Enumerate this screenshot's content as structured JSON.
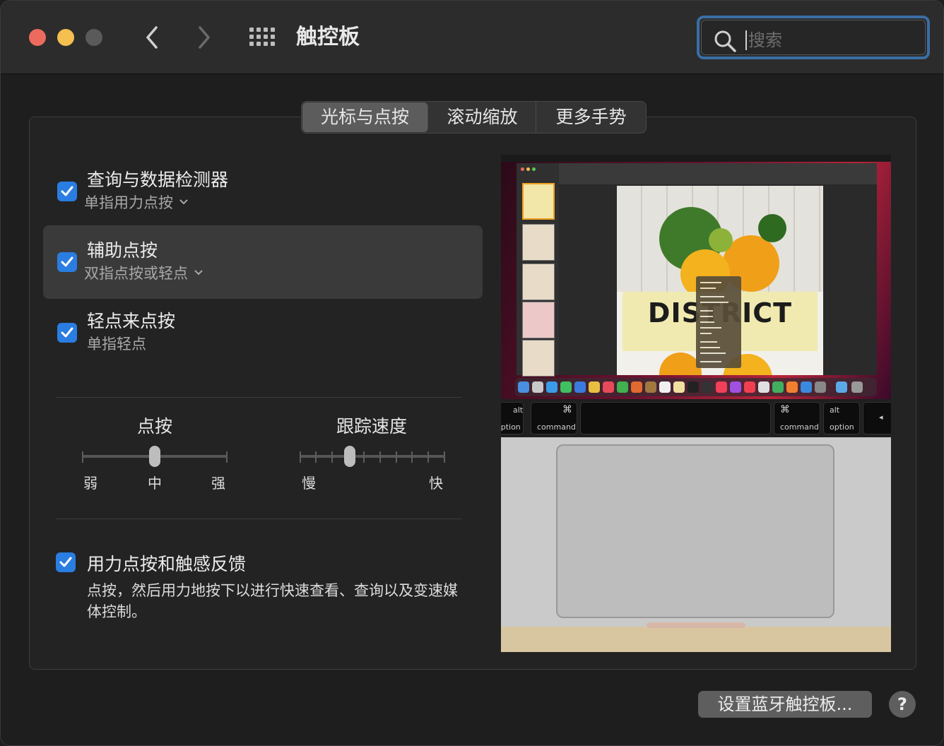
{
  "window": {
    "title": "触控板",
    "search_placeholder": "搜索"
  },
  "tabs": [
    {
      "label": "光标与点按",
      "active": true
    },
    {
      "label": "滚动缩放",
      "active": false
    },
    {
      "label": "更多手势",
      "active": false
    }
  ],
  "options": [
    {
      "title": "查询与数据检测器",
      "subtitle": "单指用力点按",
      "checked": true,
      "has_dropdown": true
    },
    {
      "title": "辅助点按",
      "subtitle": "双指点按或轻点",
      "checked": true,
      "has_dropdown": true
    },
    {
      "title": "轻点来点按",
      "subtitle": "单指轻点",
      "checked": true,
      "has_dropdown": false
    }
  ],
  "sliders": {
    "click": {
      "label": "点按",
      "min_label": "弱",
      "mid_label": "中",
      "max_label": "强",
      "value_fraction": 0.5,
      "ticks": 3
    },
    "tracking": {
      "label": "跟踪速度",
      "min_label": "慢",
      "max_label": "快",
      "value_fraction": 0.34,
      "ticks": 10
    }
  },
  "force_touch": {
    "title": "用力点按和触感反馈",
    "description": "点按，然后用力地按下以进行快速查看、查询以及变速媒体控制。",
    "checked": true
  },
  "preview": {
    "headline": "DISTRICT",
    "keys": {
      "alt_left": "alt",
      "option_left": "option",
      "cmd_symbol": "⌘",
      "command_left": "command",
      "command_right": "command",
      "alt_right": "alt",
      "option_right": "option"
    }
  },
  "buttons": {
    "bluetooth": "设置蓝牙触控板...",
    "help": "?"
  },
  "colors": {
    "accent": "#2a7de1",
    "focus_ring": "#3a6ea5",
    "close": "#ed6a5e",
    "minimize": "#f5bf4f"
  }
}
